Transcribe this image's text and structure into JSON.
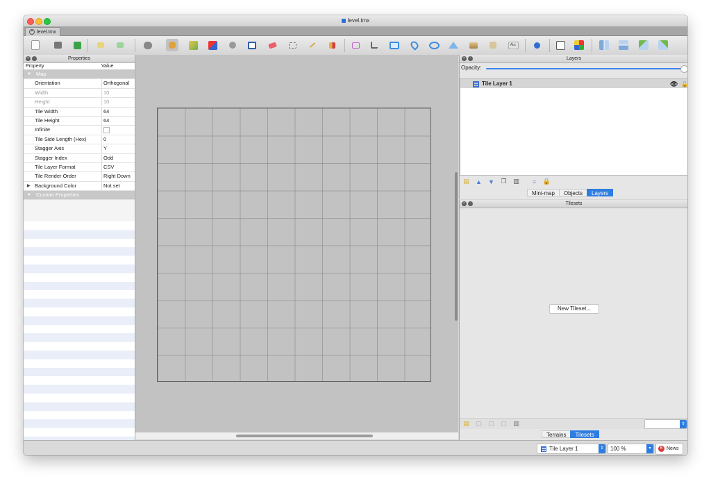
{
  "window": {
    "title": "level.tmx"
  },
  "tabs": [
    {
      "label": "level.tmx"
    }
  ],
  "toolbar": {
    "icons": [
      "new-file-icon",
      "save-icon",
      "export-icon",
      "undo-icon",
      "redo-icon",
      "stamp-brush-dropdown-icon",
      "stamp-brush-icon",
      "terrain-brush-icon",
      "wang-brush-icon",
      "bucket-fill-icon",
      "shape-fill-icon",
      "eraser-icon",
      "rectangle-select-icon",
      "magic-wand-icon",
      "select-same-tile-icon",
      "select-objects-icon",
      "edit-polygons-icon",
      "insert-rectangle-icon",
      "insert-point-icon",
      "insert-ellipse-icon",
      "insert-polygon-icon",
      "insert-tile-icon",
      "insert-template-icon",
      "insert-text-icon",
      "world-tool-icon",
      "random-mode-icon",
      "wang-fill-icon",
      "flip-horizontal-icon",
      "flip-vertical-icon",
      "rotate-left-icon",
      "rotate-right-icon"
    ]
  },
  "properties": {
    "title": "Properties",
    "col_property": "Property",
    "col_value": "Value",
    "group_map": "Map",
    "rows": [
      {
        "key": "Orientation",
        "value": "Orthogonal",
        "disabled": false
      },
      {
        "key": "Width",
        "value": "10",
        "disabled": true
      },
      {
        "key": "Height",
        "value": "10",
        "disabled": true
      },
      {
        "key": "Tile Width",
        "value": "64",
        "disabled": false
      },
      {
        "key": "Tile Height",
        "value": "64",
        "disabled": false
      },
      {
        "key": "Infinite",
        "value": "",
        "disabled": false
      },
      {
        "key": "Tile Side Length (Hex)",
        "value": "0",
        "disabled": false
      },
      {
        "key": "Stagger Axis",
        "value": "Y",
        "disabled": false
      },
      {
        "key": "Stagger Index",
        "value": "Odd",
        "disabled": false
      },
      {
        "key": "Tile Layer Format",
        "value": "CSV",
        "disabled": false
      },
      {
        "key": "Tile Render Order",
        "value": "Right Down",
        "disabled": false
      },
      {
        "key": "Background Color",
        "value": "Not set",
        "disabled": false
      }
    ],
    "group_custom": "Custom Properties"
  },
  "map": {
    "columns": 10,
    "rows": 10
  },
  "layers": {
    "title": "Layers",
    "opacity_label": "Opacity:",
    "opacity": 1.0,
    "items": [
      {
        "name": "Tile Layer 1"
      }
    ],
    "tabs": [
      {
        "label": "Mini-map",
        "active": false
      },
      {
        "label": "Objects",
        "active": false
      },
      {
        "label": "Layers",
        "active": true
      }
    ]
  },
  "tilesets": {
    "title": "Tilesets",
    "new_button": "New Tileset...",
    "tabs": [
      {
        "label": "Terrains",
        "active": false
      },
      {
        "label": "Tilesets",
        "active": true
      }
    ]
  },
  "status": {
    "layer_select": "Tile Layer 1",
    "zoom": "100 %",
    "news_count": "6",
    "news_label": "News"
  },
  "colors": {
    "accent": "#2f7de1",
    "canvas": "#c2c2c2"
  }
}
